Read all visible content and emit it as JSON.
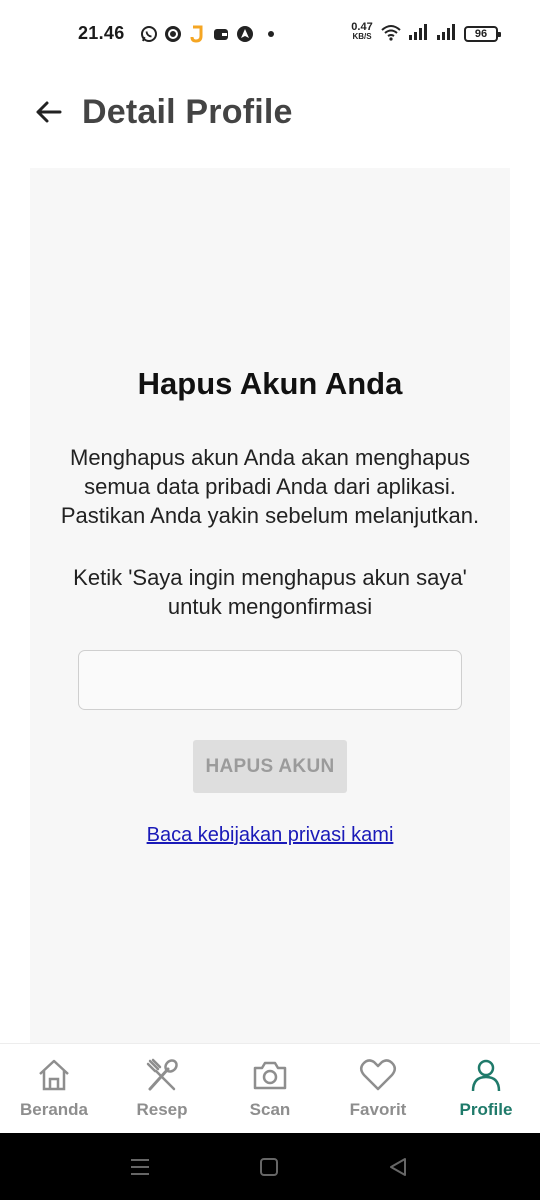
{
  "status_bar": {
    "time": "21.46",
    "net_speed_value": "0.47",
    "net_speed_unit": "KB/S",
    "battery": "96",
    "notification_icons": [
      "whatsapp-icon",
      "app-icon",
      "j-app-icon",
      "wallet-icon",
      "navigation-icon"
    ],
    "system_icons": [
      "wifi-icon",
      "signal-icon",
      "signal-icon",
      "battery-icon"
    ]
  },
  "header": {
    "title": "Detail Profile",
    "back_icon": "arrow-left-icon"
  },
  "delete_account": {
    "title": "Hapus Akun Anda",
    "description_lines": [
      "Menghapus akun Anda akan menghapus",
      "semua data pribadi Anda dari aplikasi.",
      "Pastikan Anda yakin sebelum melanjutkan."
    ],
    "instruction_lines": [
      "Ketik 'Saya ingin menghapus akun saya'",
      "untuk mengonfirmasi"
    ],
    "input_value": "",
    "button_label": "HAPUS AKUN",
    "privacy_link": "Baca kebijakan privasi kami"
  },
  "bottom_nav": {
    "items": [
      {
        "label": "Beranda",
        "icon": "home-icon",
        "active": false
      },
      {
        "label": "Resep",
        "icon": "fork-knife-icon",
        "active": false
      },
      {
        "label": "Scan",
        "icon": "camera-icon",
        "active": false
      },
      {
        "label": "Favorit",
        "icon": "heart-icon",
        "active": false
      },
      {
        "label": "Profile",
        "icon": "user-icon",
        "active": true
      }
    ]
  },
  "colors": {
    "accent": "#1f7a6a",
    "inactive": "#8e8e8e",
    "card_bg": "#f7f7f7",
    "link": "#1a1ab8",
    "button_disabled_bg": "#dedede",
    "button_disabled_text": "#9b9b9b"
  }
}
